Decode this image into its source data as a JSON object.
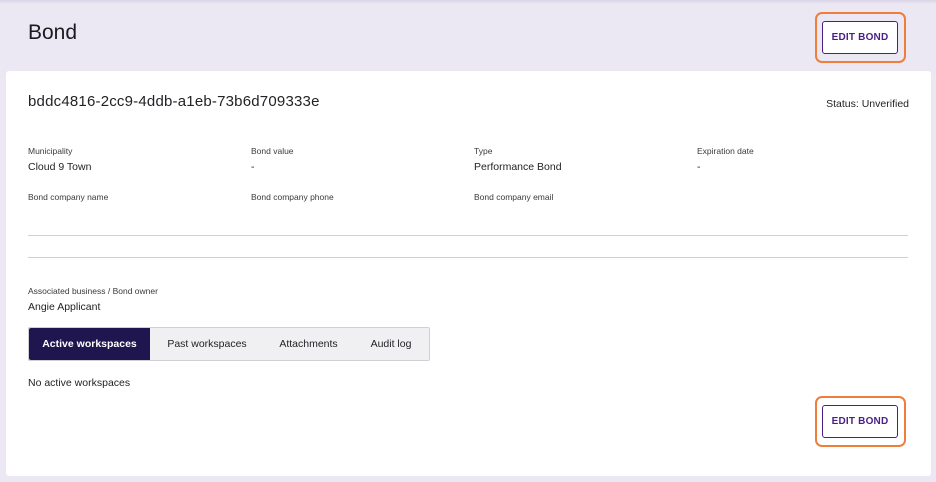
{
  "header": {
    "title": "Bond",
    "edit_label": "EDIT BOND"
  },
  "bond": {
    "id": "bddc4816-2cc9-4ddb-a1eb-73b6d709333e",
    "status": "Status: Unverified",
    "fields": {
      "municipality_label": "Municipality",
      "municipality_value": "Cloud 9 Town",
      "bond_value_label": "Bond value",
      "bond_value_value": "-",
      "type_label": "Type",
      "type_value": "Performance Bond",
      "expiration_label": "Expiration date",
      "expiration_value": "-",
      "company_name_label": "Bond company name",
      "company_phone_label": "Bond company phone",
      "company_email_label": "Bond company email"
    },
    "owner_label": "Associated business / Bond owner",
    "owner_value": "Angie Applicant"
  },
  "tabs": [
    {
      "label": "Active workspaces",
      "active": true
    },
    {
      "label": "Past workspaces",
      "active": false
    },
    {
      "label": "Attachments",
      "active": false
    },
    {
      "label": "Audit log",
      "active": false
    }
  ],
  "workspaces": {
    "empty_message": "No active workspaces"
  },
  "footer": {
    "edit_label": "EDIT BOND"
  },
  "colors": {
    "background": "#ebe7f3",
    "accent_purple": "#4b1f86",
    "active_tab": "#1f1650",
    "highlight_ring": "#ef7e3a"
  }
}
